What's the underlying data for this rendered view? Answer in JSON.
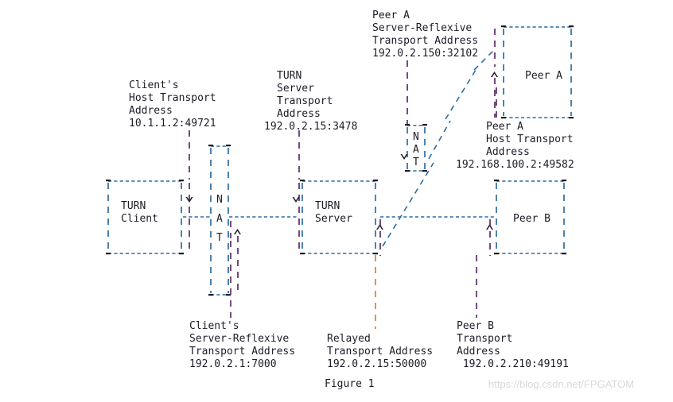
{
  "figure": {
    "caption": "Figure 1",
    "watermark": "https://blog.csdn.net/FPGATOM",
    "colors": {
      "background": "#ffffff",
      "text": "#1c1c28",
      "horizontal_rule": "#2b6ca3",
      "vertical_rule_warm": "#c98a2e",
      "vertical_rule_purple": "#5b2a6b",
      "watermark": "#d9d9dd"
    }
  },
  "labels": {
    "client_host": {
      "line1": "Client's",
      "line2": "Host Transport",
      "line3": "Address",
      "line4": "10.1.1.2:49721"
    },
    "turn_server_transport": {
      "line1": "TURN",
      "line2": "Server",
      "line3": "Transport",
      "line4": "Address",
      "line5": "192.0.2.15:3478"
    },
    "peer_a_srflx": {
      "line1": "Peer A",
      "line2": "Server-Reflexive",
      "line3": "Transport Address",
      "line4": "192.0.2.150:32102"
    },
    "peer_a_host": {
      "line1": "Peer A",
      "line2": "Host Transport",
      "line3": "Address",
      "line4": "192.168.100.2:49582"
    },
    "client_srflx": {
      "line1": "Client's",
      "line2": "Server-Reflexive",
      "line3": "Transport Address",
      "line4": "192.0.2.1:7000"
    },
    "relayed": {
      "line1": "Relayed",
      "line2": "Transport Address",
      "line3": "192.0.2.15:50000"
    },
    "peer_b_transport": {
      "line1": "Peer B",
      "line2": "Transport",
      "line3": "Address",
      "line4": " 192.0.2.210:49191"
    }
  },
  "boxes": {
    "turn_client": {
      "line1": "TURN",
      "line2": "Client"
    },
    "turn_server": {
      "line1": "TURN",
      "line2": "Server"
    },
    "peer_a": {
      "label": "Peer A"
    },
    "peer_b": {
      "label": "Peer B"
    },
    "nat_left": {
      "l1": "N",
      "l2": "A",
      "l3": "T"
    },
    "nat_right": {
      "l1": "N",
      "l2": "A",
      "l3": "T"
    }
  },
  "ascii_art": {
    "description": "RFC 5766 TURN deployment diagram rendered as monospace character art",
    "rows": [
      "                                          Peer A",
      "                                          Server-Reflexive    +---------+",
      "                                          Transport Address   |         |",
      "                                          192.0.2.150:32102   |         |",
      "                                                |            /|         |",
      "              Client's               TURN       |          / ^|  Peer A |",
      "              Host Transport         Server     |        //  ||         |",
      "              Address                Transport  |       /    ||         |",
      "              10.1.1.2:49721         Address    |     //     |+---------+",
      "                   |                 192.0.2.15:3478  |+-+  //  Peer A",
      "                   |    +-+                       |  ||N| /    Host Transport",
      "                   |    | |                       |  ||A|/     Address",
      "                   |    | |                       |  v|T|      192.168.100.2:49582",
      "       +---------+ |    | |                 +---------+/+-+",
      "       |         |%|    |N|                 |%|       / /",
      "       |  TURN   |v|    | |                 v|%TURN   |//",
      "       |  Client |-----|A|-----------------|%Server   |/----------------|  Peer B |",
      "       |         | |    | ^                 | |       |^              ^|         |",
      "       |         | |    |T||                | |       ||              |||        |",
      "       +---------+ |    | ||                +---------+|              |+---------+",
      "                   |    | ||                           |              |",
      "                   |    +-+|                           |              |",
      "                   |       |                           |              |",
      "                  Client's                          Relayed        Peer B",
      "                  Server-Reflexive                 Transport Address  Transport",
      "                  Transport Address                192.0.2.15:50000   Address",
      "                  192.0.2.1:7000                                       192.0.2.210:49191",
      "",
      "                                        Figure 1"
    ]
  }
}
